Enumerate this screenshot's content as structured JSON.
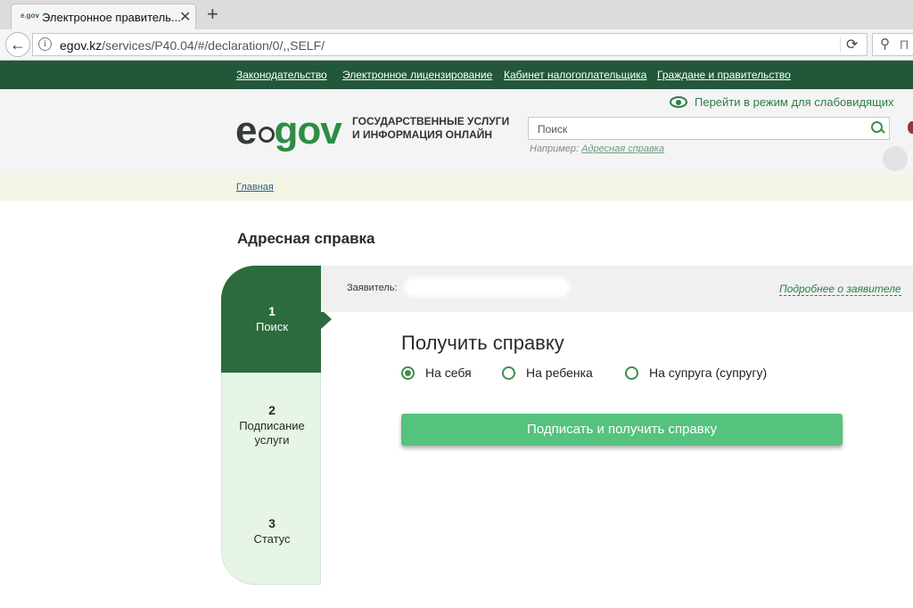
{
  "browser": {
    "tab_title": "Электронное правитель...",
    "tab_favicon": "e.gov",
    "url_host": "egov.kz",
    "url_path": "/services/P40.04/#/declaration/0/,,SELF/",
    "search_placeholder": "П"
  },
  "topnav": {
    "links": [
      "Законодательство",
      "Электронное лицензирование",
      "Кабинет налогоплательщика",
      "Граждане и правительство"
    ]
  },
  "header": {
    "logo_e": "e",
    "logo_gov": "gov",
    "tagline_line1": "ГОСУДАРСТВЕННЫЕ УСЛУГИ",
    "tagline_line2": "И ИНФОРМАЦИЯ ОНЛАЙН",
    "vision_link": "Перейти в режим для слабовидящих",
    "search_placeholder": "Поиск",
    "example_prefix": "Например:",
    "example_link": "Адресная справка"
  },
  "breadcrumb": {
    "home": "Главная"
  },
  "page": {
    "title": "Адресная справка"
  },
  "steps": [
    {
      "num": "1",
      "label": "Поиск"
    },
    {
      "num": "2",
      "label": "Подписание услуги"
    },
    {
      "num": "3",
      "label": "Статус"
    }
  ],
  "applicant": {
    "label": "Заявитель:",
    "more_link": "Подробнее о заявителе"
  },
  "form": {
    "title": "Получить справку",
    "options": [
      "На себя",
      "На ребенка",
      "На супруга (супругу)"
    ],
    "selected": "На себя",
    "submit_label": "Подписать и получить справку"
  },
  "colors": {
    "top_bar": "#23573a",
    "accent": "#2c6b3d",
    "button": "#55c27e"
  }
}
